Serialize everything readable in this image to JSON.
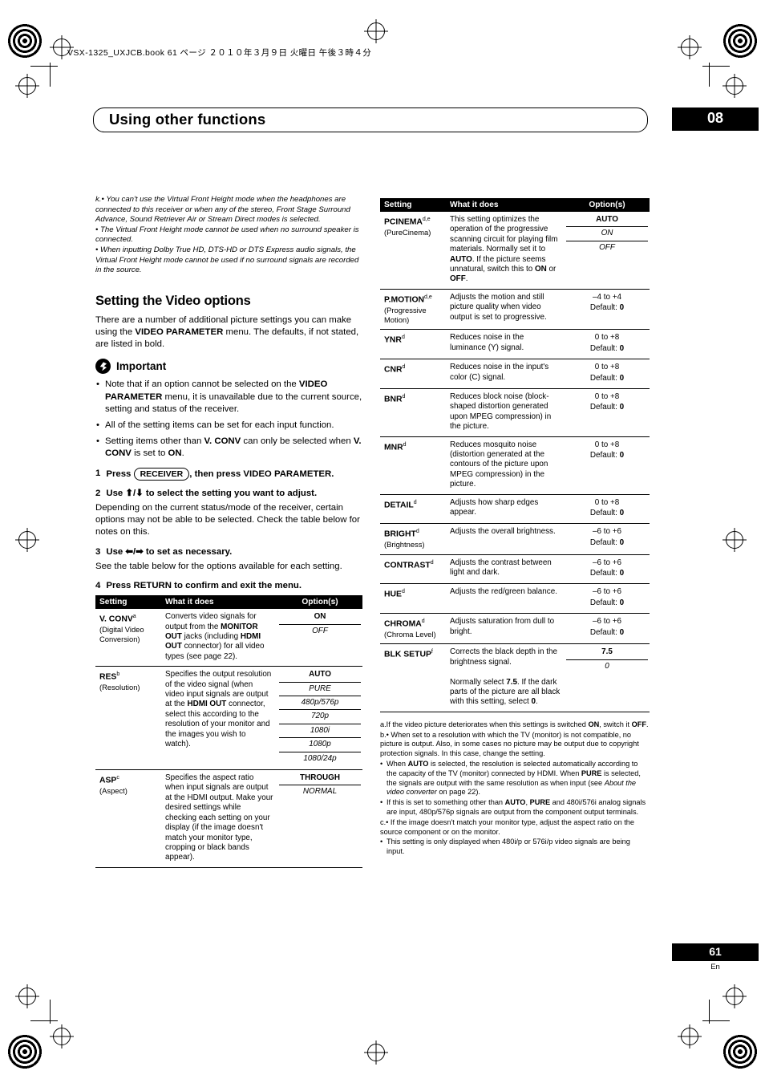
{
  "header": {
    "filestamp": "VSX-1325_UXJCB.book   61 ページ   ２０１０年３月９日   火曜日   午後３時４分",
    "running_title": "Using other functions",
    "chapter": "08"
  },
  "footer": {
    "page_number": "61",
    "language": "En"
  },
  "left_column": {
    "note_k": [
      "k.• You can't use the Virtual Front Height mode when the headphones are connected to this receiver or when any of the stereo, Front Stage Surround Advance, Sound Retriever Air or Stream Direct modes is selected.",
      "• The Virtual Front Height mode cannot be used when no surround speaker is connected.",
      "• When inputting Dolby True HD, DTS-HD or DTS Express audio signals, the Virtual Front Height mode cannot be used if no surround signals are recorded in the source."
    ],
    "heading": "Setting the Video options",
    "intro": "There are a number of additional picture settings you can make using the VIDEO PARAMETER menu. The defaults, if not stated, are listed in bold.",
    "important_label": "Important",
    "important_items": [
      "Note that if an option cannot be selected on the VIDEO PARAMETER menu, it is unavailable due to the current source, setting and status of the receiver.",
      "All of the setting items can be set for each input function.",
      "Setting items other than V. CONV can only be selected when V. CONV is set to ON."
    ],
    "steps": [
      {
        "num": "1",
        "text_before": "Press",
        "key": "RECEIVER",
        "text_after": ", then press VIDEO PARAMETER.",
        "note": ""
      },
      {
        "num": "2",
        "text_before": "Use",
        "key": "",
        "text_after": "to select the setting you want to adjust.",
        "note": "Depending on the current status/mode of the receiver, certain options may not be able to be selected. Check the table below for notes on this."
      },
      {
        "num": "3",
        "text_before": "Use",
        "key": "",
        "text_after": "to set as necessary.",
        "note": "See the table below for the options available for each setting."
      },
      {
        "num": "4",
        "text_before": "",
        "key": "",
        "text_after": "Press RETURN to confirm and exit the menu.",
        "note": ""
      }
    ],
    "table": {
      "headers": [
        "Setting",
        "What it does",
        "Option(s)"
      ],
      "rows": [
        {
          "name": "V. CONV",
          "sup": "a",
          "sub": "(Digital Video Conversion)",
          "desc": "Converts video signals for output from the MONITOR OUT jacks (including HDMI OUT connector) for all video types (see page 22).",
          "options": [
            {
              "text": "ON",
              "style": "bold"
            },
            {
              "text": "OFF",
              "style": "ital"
            }
          ]
        },
        {
          "name": "RES",
          "sup": "b",
          "sub": "(Resolution)",
          "desc": "Specifies the output resolution of the video signal (when video input signals are output at the HDMI OUT connector, select this according to the resolution of your monitor and the images you wish to watch).",
          "options": [
            {
              "text": "AUTO",
              "style": "bold"
            },
            {
              "text": "PURE",
              "style": "ital"
            },
            {
              "text": "480p/576p",
              "style": "ital"
            },
            {
              "text": "720p",
              "style": "ital"
            },
            {
              "text": "1080i",
              "style": "ital"
            },
            {
              "text": "1080p",
              "style": "ital"
            },
            {
              "text": "1080/24p",
              "style": "ital"
            }
          ]
        },
        {
          "name": "ASP",
          "sup": "c",
          "sub": "(Aspect)",
          "desc": "Specifies the aspect ratio when input signals are output at the HDMI output. Make your desired settings while checking each setting on your display (if the image doesn't match your monitor type, cropping or black bands appear).",
          "options": [
            {
              "text": "THROUGH",
              "style": "bold"
            },
            {
              "text": "NORMAL",
              "style": "ital"
            }
          ]
        }
      ]
    }
  },
  "right_column": {
    "table": {
      "headers": [
        "Setting",
        "What it does",
        "Option(s)"
      ],
      "rows": [
        {
          "name": "PCINEMA",
          "sup": "d,e",
          "sub": "(PureCinema)",
          "desc": "This setting optimizes the operation of the progressive scanning circuit for playing film materials. Normally set it to AUTO. If the picture seems unnatural, switch this to ON or OFF.",
          "options": [
            {
              "text": "AUTO",
              "style": "bold"
            },
            {
              "text": "ON",
              "style": "ital"
            },
            {
              "text": "OFF",
              "style": "ital"
            }
          ]
        },
        {
          "name": "P.MOTION",
          "sup": "d,e",
          "sub": "(Progressive Motion)",
          "desc": "Adjusts the motion and still picture quality when video output is set to progressive.",
          "options": [
            {
              "text": "–4 to +4",
              "style": "plain"
            },
            {
              "text": "Default: 0",
              "style": "default"
            }
          ]
        },
        {
          "name": "YNR",
          "sup": "d",
          "sub": "",
          "desc": "Reduces noise in the luminance (Y) signal.",
          "options": [
            {
              "text": "0 to +8",
              "style": "plain"
            },
            {
              "text": "Default: 0",
              "style": "default"
            }
          ]
        },
        {
          "name": "CNR",
          "sup": "d",
          "sub": "",
          "desc": "Reduces noise in the input's color (C) signal.",
          "options": [
            {
              "text": "0 to +8",
              "style": "plain"
            },
            {
              "text": "Default: 0",
              "style": "default"
            }
          ]
        },
        {
          "name": "BNR",
          "sup": "d",
          "sub": "",
          "desc": "Reduces block noise (block-shaped distortion generated upon MPEG compression) in the picture.",
          "options": [
            {
              "text": "0 to +8",
              "style": "plain"
            },
            {
              "text": "Default: 0",
              "style": "default"
            }
          ]
        },
        {
          "name": "MNR",
          "sup": "d",
          "sub": "",
          "desc": "Reduces mosquito noise (distortion generated at the contours of the picture upon MPEG compression) in the picture.",
          "options": [
            {
              "text": "0 to +8",
              "style": "plain"
            },
            {
              "text": "Default: 0",
              "style": "default"
            }
          ]
        },
        {
          "name": "DETAIL",
          "sup": "d",
          "sub": "",
          "desc": "Adjusts how sharp edges appear.",
          "options": [
            {
              "text": "0 to +8",
              "style": "plain"
            },
            {
              "text": "Default: 0",
              "style": "default"
            }
          ]
        },
        {
          "name": "BRIGHT",
          "sup": "d",
          "sub": "(Brightness)",
          "desc": "Adjusts the overall brightness.",
          "options": [
            {
              "text": "–6 to +6",
              "style": "plain"
            },
            {
              "text": "Default: 0",
              "style": "default"
            }
          ]
        },
        {
          "name": "CONTRAST",
          "sup": "d",
          "sub": "",
          "desc": "Adjusts the contrast between light and dark.",
          "options": [
            {
              "text": "–6 to +6",
              "style": "plain"
            },
            {
              "text": "Default: 0",
              "style": "default"
            }
          ]
        },
        {
          "name": "HUE",
          "sup": "d",
          "sub": "",
          "desc": "Adjusts the red/green balance.",
          "options": [
            {
              "text": "–6 to +6",
              "style": "plain"
            },
            {
              "text": "Default: 0",
              "style": "default"
            }
          ]
        },
        {
          "name": "CHROMA",
          "sup": "d",
          "sub": "(Chroma Level)",
          "desc": "Adjusts saturation from dull to bright.",
          "options": [
            {
              "text": "–6 to +6",
              "style": "plain"
            },
            {
              "text": "Default: 0",
              "style": "default"
            }
          ]
        },
        {
          "name": "BLK SETUP",
          "sup": "f",
          "sub": "",
          "desc": "Corrects the black depth in the brightness signal.\nNormally select 7.5. If the dark parts of the picture are all black with this setting, select 0.",
          "options": [
            {
              "text": "7.5",
              "style": "bold"
            },
            {
              "text": "0",
              "style": "ital"
            }
          ]
        }
      ]
    },
    "footnotes": [
      {
        "marker": "a.",
        "lines": [
          "If the video picture deteriorates when this settings is switched ON, switch it OFF."
        ]
      },
      {
        "marker": "b.",
        "lines": [
          "• When set to a resolution with which the TV (monitor) is not compatible, no picture is output. Also, in some cases no picture may be output due to copyright protection signals. In this case, change the setting.",
          "• When AUTO is selected, the resolution is selected automatically according to the capacity of the TV (monitor) connected by HDMI. When PURE is selected, the signals are output with the same resolution as when input (see About the video converter on page 22).",
          "• If this is set to something other than AUTO, PURE and 480i/576i analog signals are input, 480p/576p signals are output from the component output terminals."
        ]
      },
      {
        "marker": "c.",
        "lines": [
          "• If the image doesn't match your monitor type, adjust the aspect ratio on the source component or on the monitor.",
          "• This setting is only displayed when 480i/p or 576i/p video signals are being input."
        ]
      }
    ]
  }
}
